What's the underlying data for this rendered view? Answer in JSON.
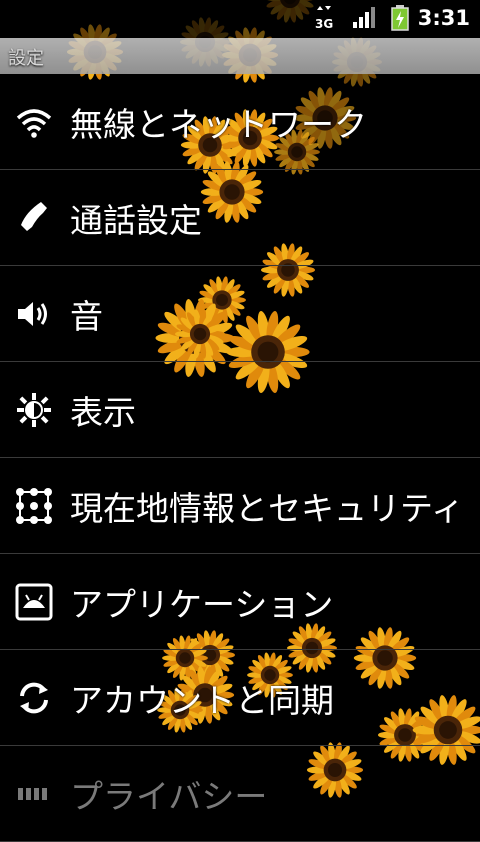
{
  "status_bar": {
    "network_type": "3G",
    "time": "3:31"
  },
  "title_bar": {
    "title": "設定"
  },
  "settings": [
    {
      "label": "無線とネットワーク",
      "icon": "wifi-icon"
    },
    {
      "label": "通話設定",
      "icon": "phone-icon"
    },
    {
      "label": "音",
      "icon": "speaker-icon"
    },
    {
      "label": "表示",
      "icon": "brightness-icon"
    },
    {
      "label": "現在地情報とセキュリティ",
      "icon": "location-security-icon"
    },
    {
      "label": "アプリケーション",
      "icon": "applications-icon"
    },
    {
      "label": "アカウントと同期",
      "icon": "sync-icon"
    },
    {
      "label": "プライバシー",
      "icon": "privacy-icon"
    }
  ],
  "colors": {
    "background": "#000000",
    "title_bar": "#b8b8b8",
    "divider": "#3a3a3a",
    "battery_green": "#7ec832"
  }
}
